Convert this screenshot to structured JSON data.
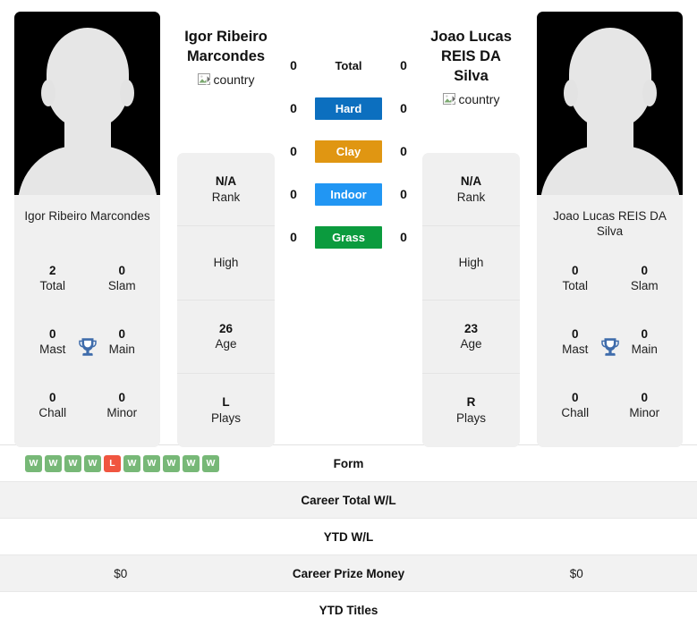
{
  "players": {
    "left": {
      "name": "Igor Ribeiro Marcondes",
      "photo_caption": "Igor Ribeiro Marcondes",
      "country_alt": "country",
      "rank": "N/A",
      "rank_label": "Rank",
      "high": "",
      "high_label": "High",
      "age": "26",
      "age_label": "Age",
      "plays": "L",
      "plays_label": "Plays",
      "titles": {
        "total": "2",
        "total_label": "Total",
        "slam": "0",
        "slam_label": "Slam",
        "mast": "0",
        "mast_label": "Mast",
        "main": "0",
        "main_label": "Main",
        "chall": "0",
        "chall_label": "Chall",
        "minor": "0",
        "minor_label": "Minor"
      }
    },
    "right": {
      "name": "Joao Lucas REIS DA Silva",
      "photo_caption": "Joao Lucas REIS DA Silva",
      "country_alt": "country",
      "rank": "N/A",
      "rank_label": "Rank",
      "high": "",
      "high_label": "High",
      "age": "23",
      "age_label": "Age",
      "plays": "R",
      "plays_label": "Plays",
      "titles": {
        "total": "0",
        "total_label": "Total",
        "slam": "0",
        "slam_label": "Slam",
        "mast": "0",
        "mast_label": "Mast",
        "main": "0",
        "main_label": "Main",
        "chall": "0",
        "chall_label": "Chall",
        "minor": "0",
        "minor_label": "Minor"
      }
    }
  },
  "surfaces": [
    {
      "label": "Total",
      "left": "0",
      "right": "0",
      "color": "transparent",
      "plain": true
    },
    {
      "label": "Hard",
      "left": "0",
      "right": "0",
      "color": "#0c6fbf",
      "plain": false
    },
    {
      "label": "Clay",
      "left": "0",
      "right": "0",
      "color": "#e09612",
      "plain": false
    },
    {
      "label": "Indoor",
      "left": "0",
      "right": "0",
      "color": "#2196f3",
      "plain": false
    },
    {
      "label": "Grass",
      "left": "0",
      "right": "0",
      "color": "#0b9b3e",
      "plain": false
    }
  ],
  "stats_rows": [
    {
      "label": "Form",
      "striped": false,
      "left_form": [
        "W",
        "W",
        "W",
        "W",
        "L",
        "W",
        "W",
        "W",
        "W",
        "W"
      ],
      "right_form": [],
      "left_value": "",
      "right_value": ""
    },
    {
      "label": "Career Total W/L",
      "striped": true,
      "left_form": [],
      "right_form": [],
      "left_value": "",
      "right_value": ""
    },
    {
      "label": "YTD W/L",
      "striped": false,
      "left_form": [],
      "right_form": [],
      "left_value": "",
      "right_value": ""
    },
    {
      "label": "Career Prize Money",
      "striped": true,
      "left_form": [],
      "right_form": [],
      "left_value": "$0",
      "right_value": "$0"
    },
    {
      "label": "YTD Titles",
      "striped": false,
      "left_form": [],
      "right_form": [],
      "left_value": "",
      "right_value": ""
    }
  ],
  "colors": {
    "win_badge": "#77b877",
    "loss_badge": "#f05540",
    "trophy": "#3f6cab",
    "card_bg": "#f0f0f0",
    "stripe_bg": "#f2f2f2"
  }
}
